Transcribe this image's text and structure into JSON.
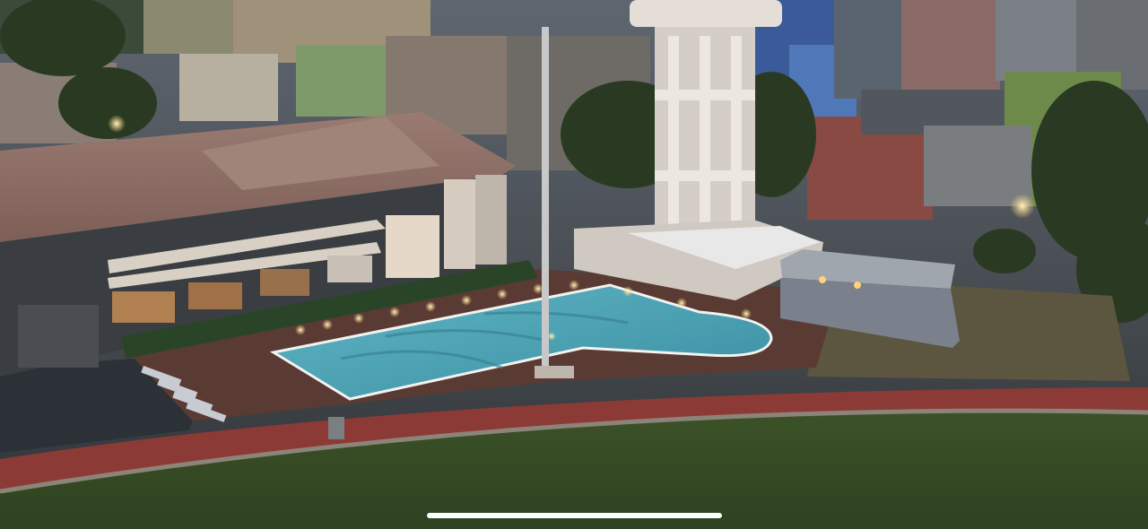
{
  "photo": {
    "subject": "aerial-view",
    "colors": {
      "sky_dusk": "#6d7a84",
      "pool_water": "#4aa6b8",
      "deck": "#5a3b34",
      "track": "#8c3a35",
      "grass": "#3f5a2a",
      "roof": "#8a6a60",
      "tower": "#dcd6cf",
      "warm_light": "#ffd27a"
    }
  },
  "system_ui": {
    "home_indicator": "home-indicator"
  }
}
